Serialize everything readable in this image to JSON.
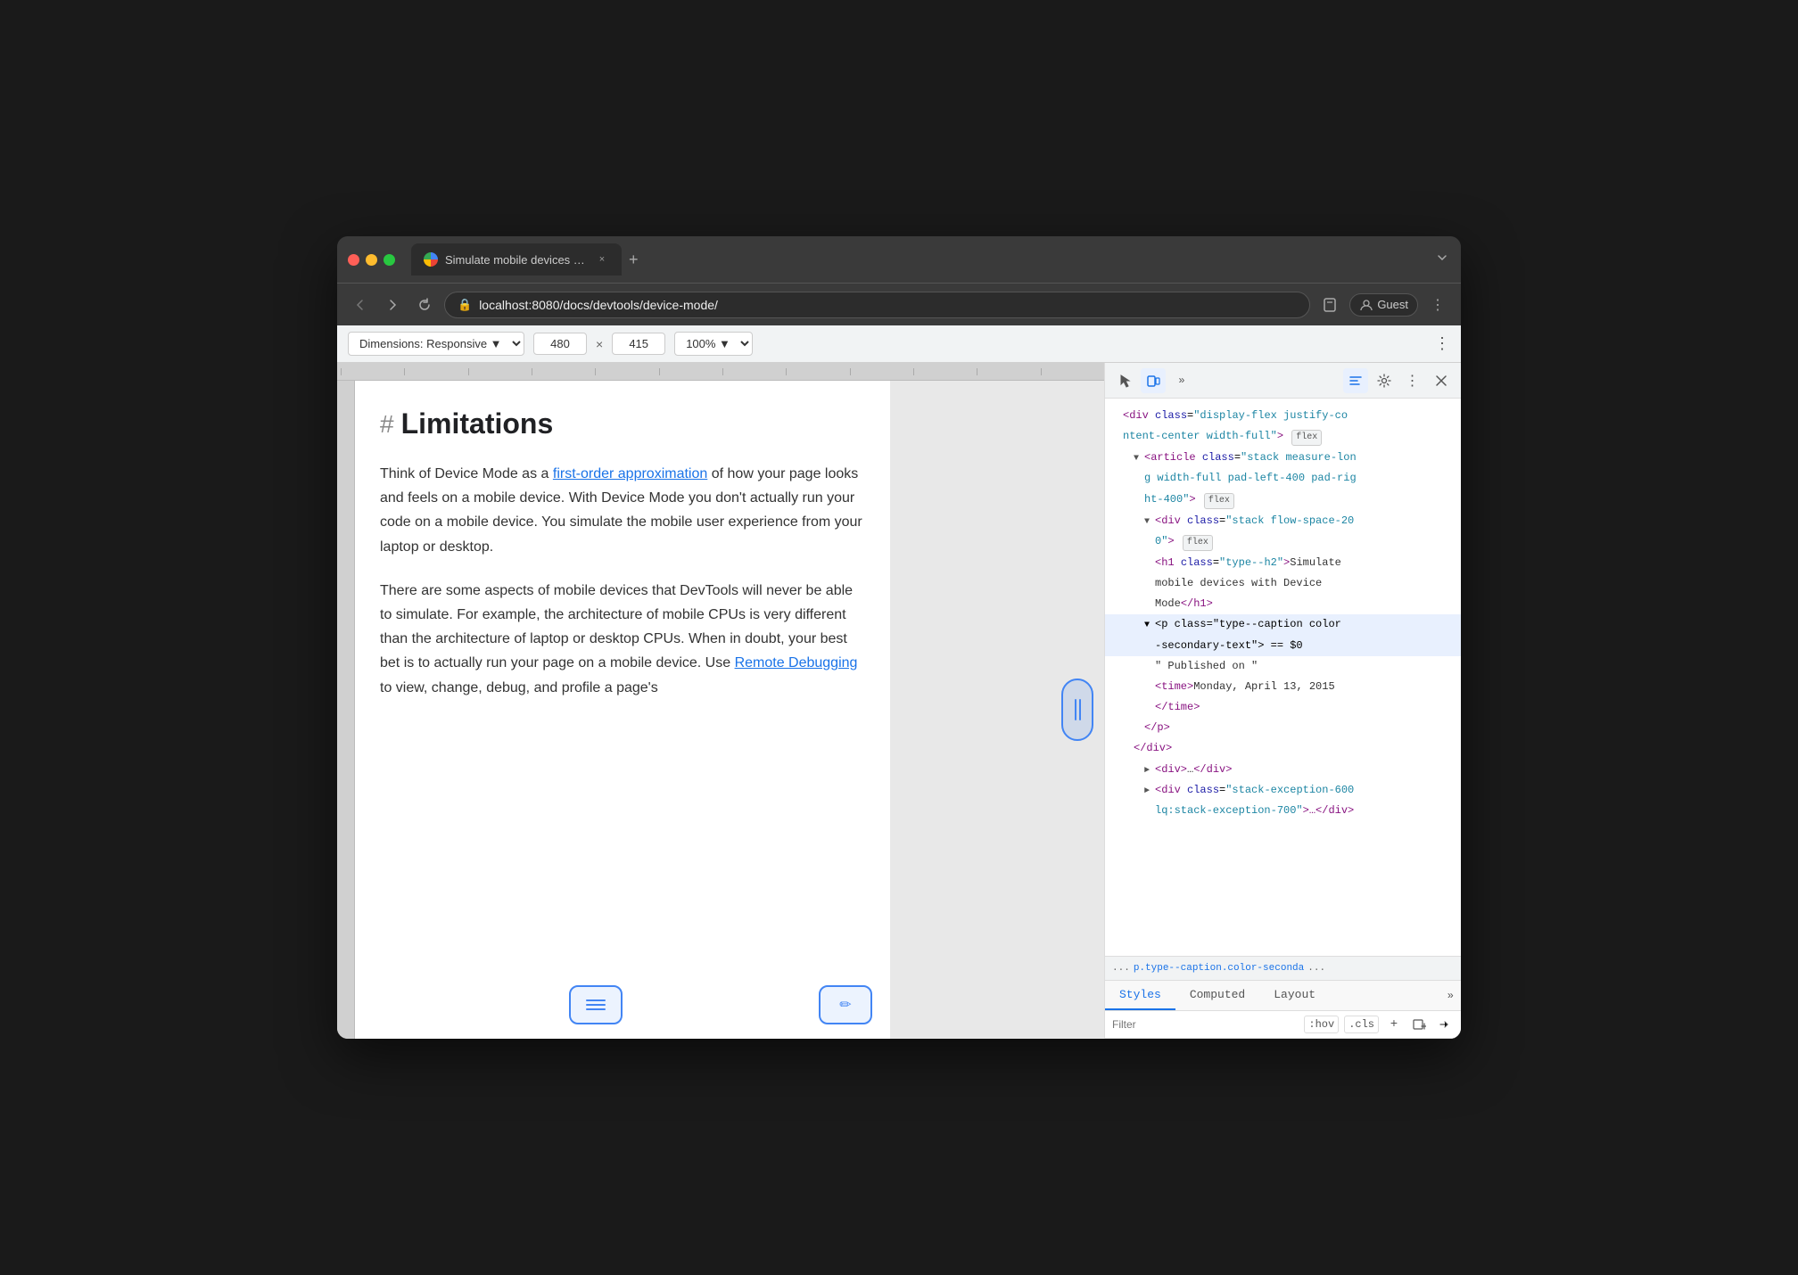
{
  "browser": {
    "traffic_lights": [
      "red",
      "yellow",
      "green"
    ],
    "tab": {
      "title": "Simulate mobile devices with D",
      "close_label": "×"
    },
    "new_tab_label": "+",
    "overflow_label": "∨",
    "nav": {
      "back_label": "←",
      "forward_label": "→",
      "refresh_label": "↻"
    },
    "url": "localhost:8080/docs/devtools/device-mode/",
    "guest_label": "Guest",
    "more_label": "⋮"
  },
  "device_toolbar": {
    "dimensions_label": "Dimensions: Responsive ▼",
    "width_value": "480",
    "height_value": "415",
    "separator": "×",
    "zoom_label": "100% ▼",
    "more_label": "⋮"
  },
  "page": {
    "hash": "#",
    "heading": "Limitations",
    "para1": "Think of Device Mode as a first-order approximation of how your page looks and feels on a mobile device. With Device Mode you don't actually run your code on a mobile device. You simulate the mobile user experience from your laptop or desktop.",
    "para1_link": "first-order approximation",
    "para2": "There are some aspects of mobile devices that DevTools will never be able to simulate. For example, the architecture of mobile CPUs is very different than the architecture of laptop or desktop CPUs. When in doubt, your best bet is to actually run your page on a mobile device. Use Remote Debugging to view, change, debug, and profile a page's",
    "para2_link": "Remote Debugging"
  },
  "devtools": {
    "toolbar_icons": [
      "cursor",
      "device",
      "overflow",
      "chat",
      "gear",
      "more",
      "close"
    ],
    "html_nodes": [
      {
        "indent": 0,
        "content": "<div class=\"display-flex justify-co",
        "suffix": "ntent-center width-full\">",
        "badge": "flex",
        "selected": false
      },
      {
        "indent": 1,
        "arrow": "▼",
        "content": "<article class=\"stack measure-lon",
        "suffix": "g width-full pad-left-400 pad-rig",
        "line2": "ht-400\">",
        "badge": "flex",
        "selected": false
      },
      {
        "indent": 2,
        "arrow": "▼",
        "tag": "div",
        "class_val": "stack flow-space-20",
        "suffix": "0\">",
        "badge": "flex",
        "selected": false
      },
      {
        "indent": 3,
        "tag": "h1",
        "class_val": "type--h2",
        "text": "Simulate mobile devices with Device Mode</h1>",
        "selected": false
      },
      {
        "indent": 3,
        "arrow": "▼",
        "tag": "p",
        "class_val": "type--caption color",
        "suffix": "-secondary-text\">",
        "dollar": "== $0",
        "selected": true
      },
      {
        "indent": 4,
        "text": "\" Published on \"",
        "selected": false
      },
      {
        "indent": 4,
        "tag": "time",
        "text": "Monday, April 13, 2015",
        "selected": false
      },
      {
        "indent": 4,
        "close": "</time>",
        "selected": false
      },
      {
        "indent": 3,
        "close": "</p>",
        "selected": false
      },
      {
        "indent": 2,
        "close": "</div>",
        "selected": false
      },
      {
        "indent": 2,
        "arrow": "►",
        "content": "<div>…</div>",
        "selected": false
      },
      {
        "indent": 2,
        "arrow": "►",
        "tag": "div",
        "class_val": "stack-exception-600",
        "suffix": "lq:stack-exception-700\">…</div>",
        "selected": false
      }
    ],
    "breadcrumb": "p.type--caption.color-seconda",
    "breadcrumb_ellipsis": "...",
    "styles_tabs": [
      "Styles",
      "Computed",
      "Layout"
    ],
    "styles_tab_active": "Styles",
    "filter_placeholder": "Filter",
    "filter_pseudo": ":hov",
    "filter_cls": ".cls",
    "filter_plus": "+",
    "filter_icon1": "⊞",
    "filter_icon2": "◁"
  }
}
